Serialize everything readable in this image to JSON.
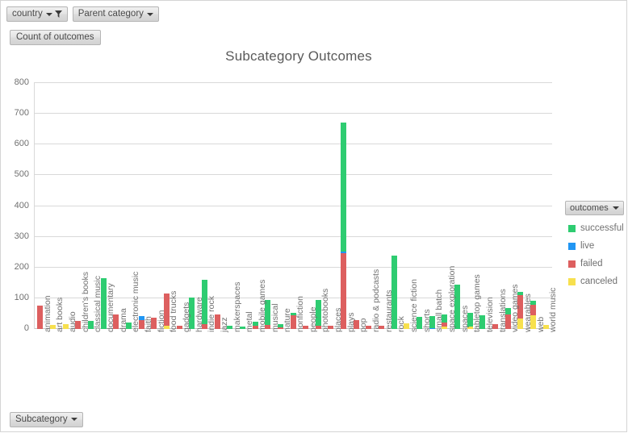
{
  "window": {
    "background": "#ffffff"
  },
  "filters": [
    {
      "label": "country",
      "icon": "filter-funnel-icon",
      "has_caret": true,
      "has_funnel": true
    },
    {
      "label": "Parent category",
      "icon": "chevron-down-icon",
      "has_caret": true,
      "has_funnel": false
    }
  ],
  "value_button": {
    "label": "Count of outcomes"
  },
  "bottom_button": {
    "label": "Subcategory",
    "has_caret": true
  },
  "legend": {
    "header_label": "outcomes",
    "items": [
      {
        "label": "successful",
        "color": "#2ecc71"
      },
      {
        "label": "live",
        "color": "#2196f3"
      },
      {
        "label": "failed",
        "color": "#dd5f5f"
      },
      {
        "label": "canceled",
        "color": "#f7e04e"
      }
    ]
  },
  "chart_data": {
    "type": "bar",
    "stacked": true,
    "title": "Subcategory Outcomes",
    "xlabel": "",
    "ylabel": "",
    "ylim": [
      0,
      800
    ],
    "ytick_step": 100,
    "yticks": [
      0,
      100,
      200,
      300,
      400,
      500,
      600,
      700,
      800
    ],
    "grid": true,
    "legend_position": "right",
    "categories": [
      "animation",
      "art books",
      "audio",
      "children's books",
      "classical music",
      "documentary",
      "drama",
      "electronic music",
      "faith",
      "fiction",
      "food trucks",
      "gadgets",
      "hardware",
      "indie rock",
      "jazz",
      "makerspaces",
      "metal",
      "mobile games",
      "musical",
      "nature",
      "nonfiction",
      "people",
      "photobooks",
      "places",
      "plays",
      "pop",
      "radio & podcasts",
      "restaurants",
      "rock",
      "science fiction",
      "shorts",
      "small batch",
      "space exploration",
      "spaces",
      "tabletop games",
      "television",
      "translations",
      "video games",
      "wearables",
      "web",
      "world music"
    ],
    "series": [
      {
        "name": "successful",
        "color": "#2ecc71",
        "values": [
          0,
          0,
          0,
          0,
          25,
          165,
          0,
          22,
          0,
          0,
          0,
          0,
          103,
          143,
          0,
          11,
          8,
          12,
          80,
          10,
          9,
          0,
          85,
          0,
          421,
          0,
          0,
          0,
          240,
          0,
          40,
          40,
          25,
          143,
          43,
          44,
          0,
          22,
          10,
          12,
          0
        ]
      },
      {
        "name": "live",
        "color": "#2196f3",
        "values": [
          0,
          0,
          0,
          0,
          0,
          0,
          0,
          0,
          13,
          0,
          0,
          0,
          0,
          0,
          0,
          0,
          0,
          0,
          0,
          0,
          0,
          0,
          0,
          0,
          4,
          0,
          0,
          0,
          0,
          0,
          0,
          3,
          0,
          0,
          0,
          0,
          0,
          0,
          0,
          0,
          0
        ]
      },
      {
        "name": "failed",
        "color": "#dd5f5f",
        "values": [
          77,
          0,
          0,
          27,
          0,
          0,
          47,
          0,
          30,
          37,
          105,
          10,
          0,
          17,
          47,
          0,
          0,
          11,
          14,
          6,
          44,
          11,
          10,
          10,
          247,
          29,
          11,
          11,
          0,
          0,
          0,
          0,
          13,
          0,
          0,
          0,
          17,
          46,
          75,
          34,
          0
        ]
      },
      {
        "name": "canceled",
        "color": "#f7e04e",
        "values": [
          0,
          14,
          17,
          0,
          0,
          0,
          0,
          0,
          0,
          0,
          10,
          0,
          0,
          0,
          0,
          0,
          0,
          0,
          0,
          0,
          0,
          0,
          0,
          0,
          0,
          0,
          0,
          0,
          0,
          19,
          0,
          0,
          8,
          0,
          9,
          0,
          0,
          0,
          35,
          45,
          14
        ]
      }
    ]
  }
}
